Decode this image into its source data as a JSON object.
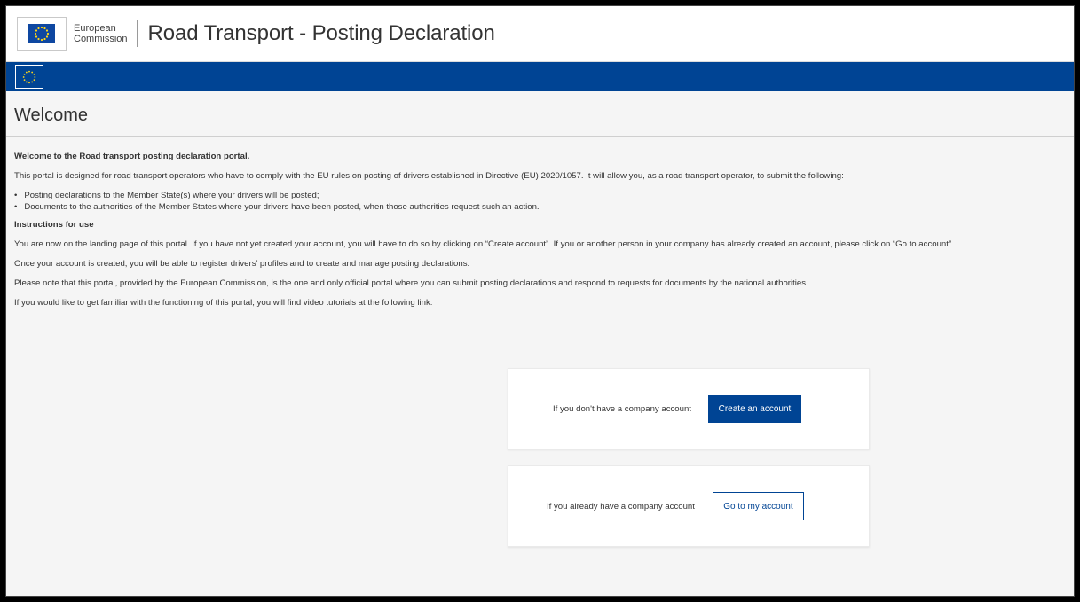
{
  "header": {
    "logo_line1": "European",
    "logo_line2": "Commission",
    "site_title": "Road Transport - Posting Declaration"
  },
  "page": {
    "title": "Welcome"
  },
  "intro": {
    "heading": "Welcome to the Road transport posting declaration portal.",
    "paragraph": "This portal is designed for road transport operators who have to comply with the EU rules on posting of drivers established in Directive (EU) 2020/1057. It will allow you, as a road transport operator, to submit the following:",
    "bullets": [
      "Posting declarations to the Member State(s) where your drivers will be posted;",
      "Documents to the authorities of the Member States where your drivers have been posted, when those authorities request such an action."
    ]
  },
  "instructions": {
    "heading": "Instructions for use",
    "p1": "You are now on the landing page of this portal. If you have not yet created your account, you will have to do so by clicking on “Create account”. If you or another person in your company has already created an account, please click on “Go to account”.",
    "p2": "Once your account is created, you will be able to register drivers’ profiles and to create and manage posting declarations.",
    "p3": "Please note that this portal, provided by the European Commission, is the one and only official portal where you can submit posting declarations and respond to requests for documents by the national authorities.",
    "p4": "If you would like to get familiar with the functioning of this portal, you will find video tutorials at the following link:"
  },
  "cards": {
    "create": {
      "label": "If you don't have a company account",
      "button": "Create an account"
    },
    "goto": {
      "label": "If you already have a company account",
      "button": "Go to my account"
    }
  },
  "colors": {
    "brand_blue": "#004494",
    "flag_blue": "#0e47a1",
    "star_yellow": "#ffd617"
  },
  "icons": {
    "header_logo": "eu-flag-icon",
    "bluebar_logo": "eu-stars-icon"
  }
}
